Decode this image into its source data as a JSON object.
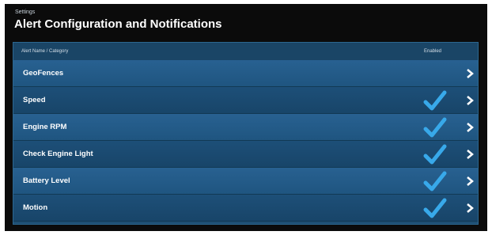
{
  "breadcrumb": "Settings",
  "title": "Alert Configuration and Notifications",
  "table": {
    "col_name": "Alert Name / Category",
    "col_enabled": "Enabled",
    "rows": [
      {
        "label": "GeoFences",
        "enabled": false
      },
      {
        "label": "Speed",
        "enabled": true
      },
      {
        "label": "Engine RPM",
        "enabled": true
      },
      {
        "label": "Check Engine Light",
        "enabled": true
      },
      {
        "label": "Battery Level",
        "enabled": true
      },
      {
        "label": "Motion",
        "enabled": true
      }
    ]
  },
  "icons": {
    "check": "checkmark-icon",
    "chevron": "chevron-right-icon"
  },
  "colors": {
    "panel": "#1e4f73",
    "check": "#38a9ea",
    "background": "#0b0b0b"
  }
}
